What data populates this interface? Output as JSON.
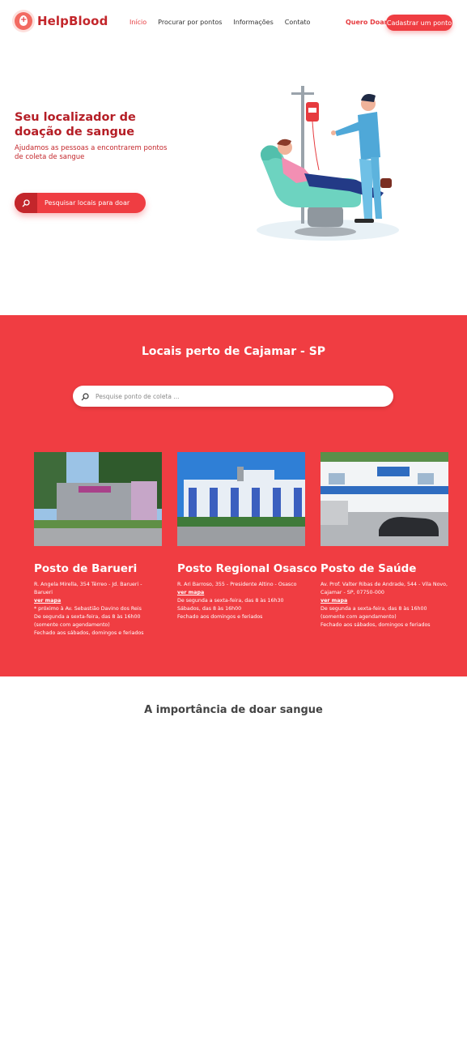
{
  "header": {
    "brand": "HelpBlood",
    "nav": [
      "Início",
      "Procurar por pontos",
      "Informações",
      "Contato"
    ],
    "quero_doar": "Quero Doar",
    "cadastrar": "Cadastrar um ponto"
  },
  "hero": {
    "title": "Seu localizador de doação de sangue",
    "subtitle": "Ajudamos as pessoas a encontrarem pontos de coleta de sangue",
    "button": "Pesquisar locais para doar"
  },
  "locais": {
    "title": "Locais perto de Cajamar - SP",
    "search_placeholder": "Pesquise ponto de coleta ...",
    "cards": [
      {
        "name": "Posto de Barueri",
        "address": "R. Angela Mirella, 354 Térreo - Jd. Barueri - Barueri",
        "link": "ver mapa",
        "lines": [
          "* próximo à Av. Sebastião Davino dos Reis",
          "De segunda a sexta-feira, das 8 às 16h00 (somente com agendamento)",
          "Fechado aos sábados, domingos e feriados"
        ]
      },
      {
        "name": "Posto Regional Osasco",
        "address": "R. Ari Barroso, 355 - Presidente Altino - Osasco",
        "link": "ver mapa",
        "lines": [
          "De segunda a sexta-feira, das 8 às 16h30",
          "Sábados, das 8 às 16h00",
          "Fechado aos domingos e feriados"
        ]
      },
      {
        "name": "Posto de Saúde",
        "address": "Av. Prof. Valter Ribas de Andrade, 544 - Vila Novo, Cajamar - SP, 07750-000",
        "link": "ver mapa",
        "lines": [
          "De segunda a sexta-feira, das 8 às 16h00 (somente com agendamento)",
          "Fechado aos sábados, domingos e feriados"
        ]
      }
    ]
  },
  "importance": {
    "title": "A importância de doar sangue"
  },
  "colors": {
    "brand_red": "#f03d42",
    "dark_red": "#b51e26"
  }
}
